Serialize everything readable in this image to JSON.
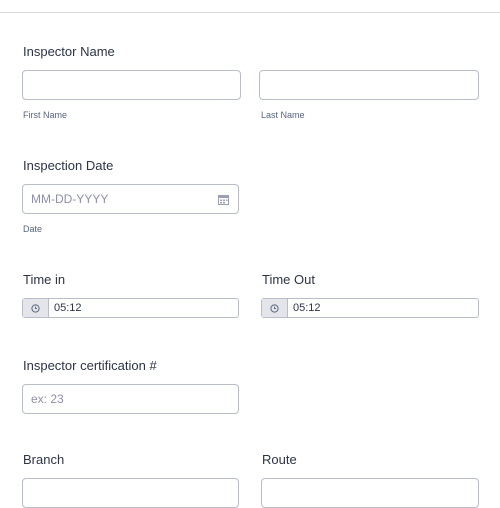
{
  "inspector_name": {
    "label": "Inspector Name",
    "first_sublabel": "First Name",
    "last_sublabel": "Last Name",
    "first_value": "",
    "last_value": ""
  },
  "inspection_date": {
    "label": "Inspection Date",
    "placeholder": "MM-DD-YYYY",
    "sublabel": "Date",
    "icon": "calendar-icon"
  },
  "time_in": {
    "label": "Time in",
    "value": "05:12",
    "icon": "clock-icon"
  },
  "time_out": {
    "label": "Time Out",
    "value": "05:12",
    "icon": "clock-icon"
  },
  "certification": {
    "label": "Inspector certification #",
    "placeholder": "ex: 23"
  },
  "branch": {
    "label": "Branch"
  },
  "route": {
    "label": "Route"
  }
}
